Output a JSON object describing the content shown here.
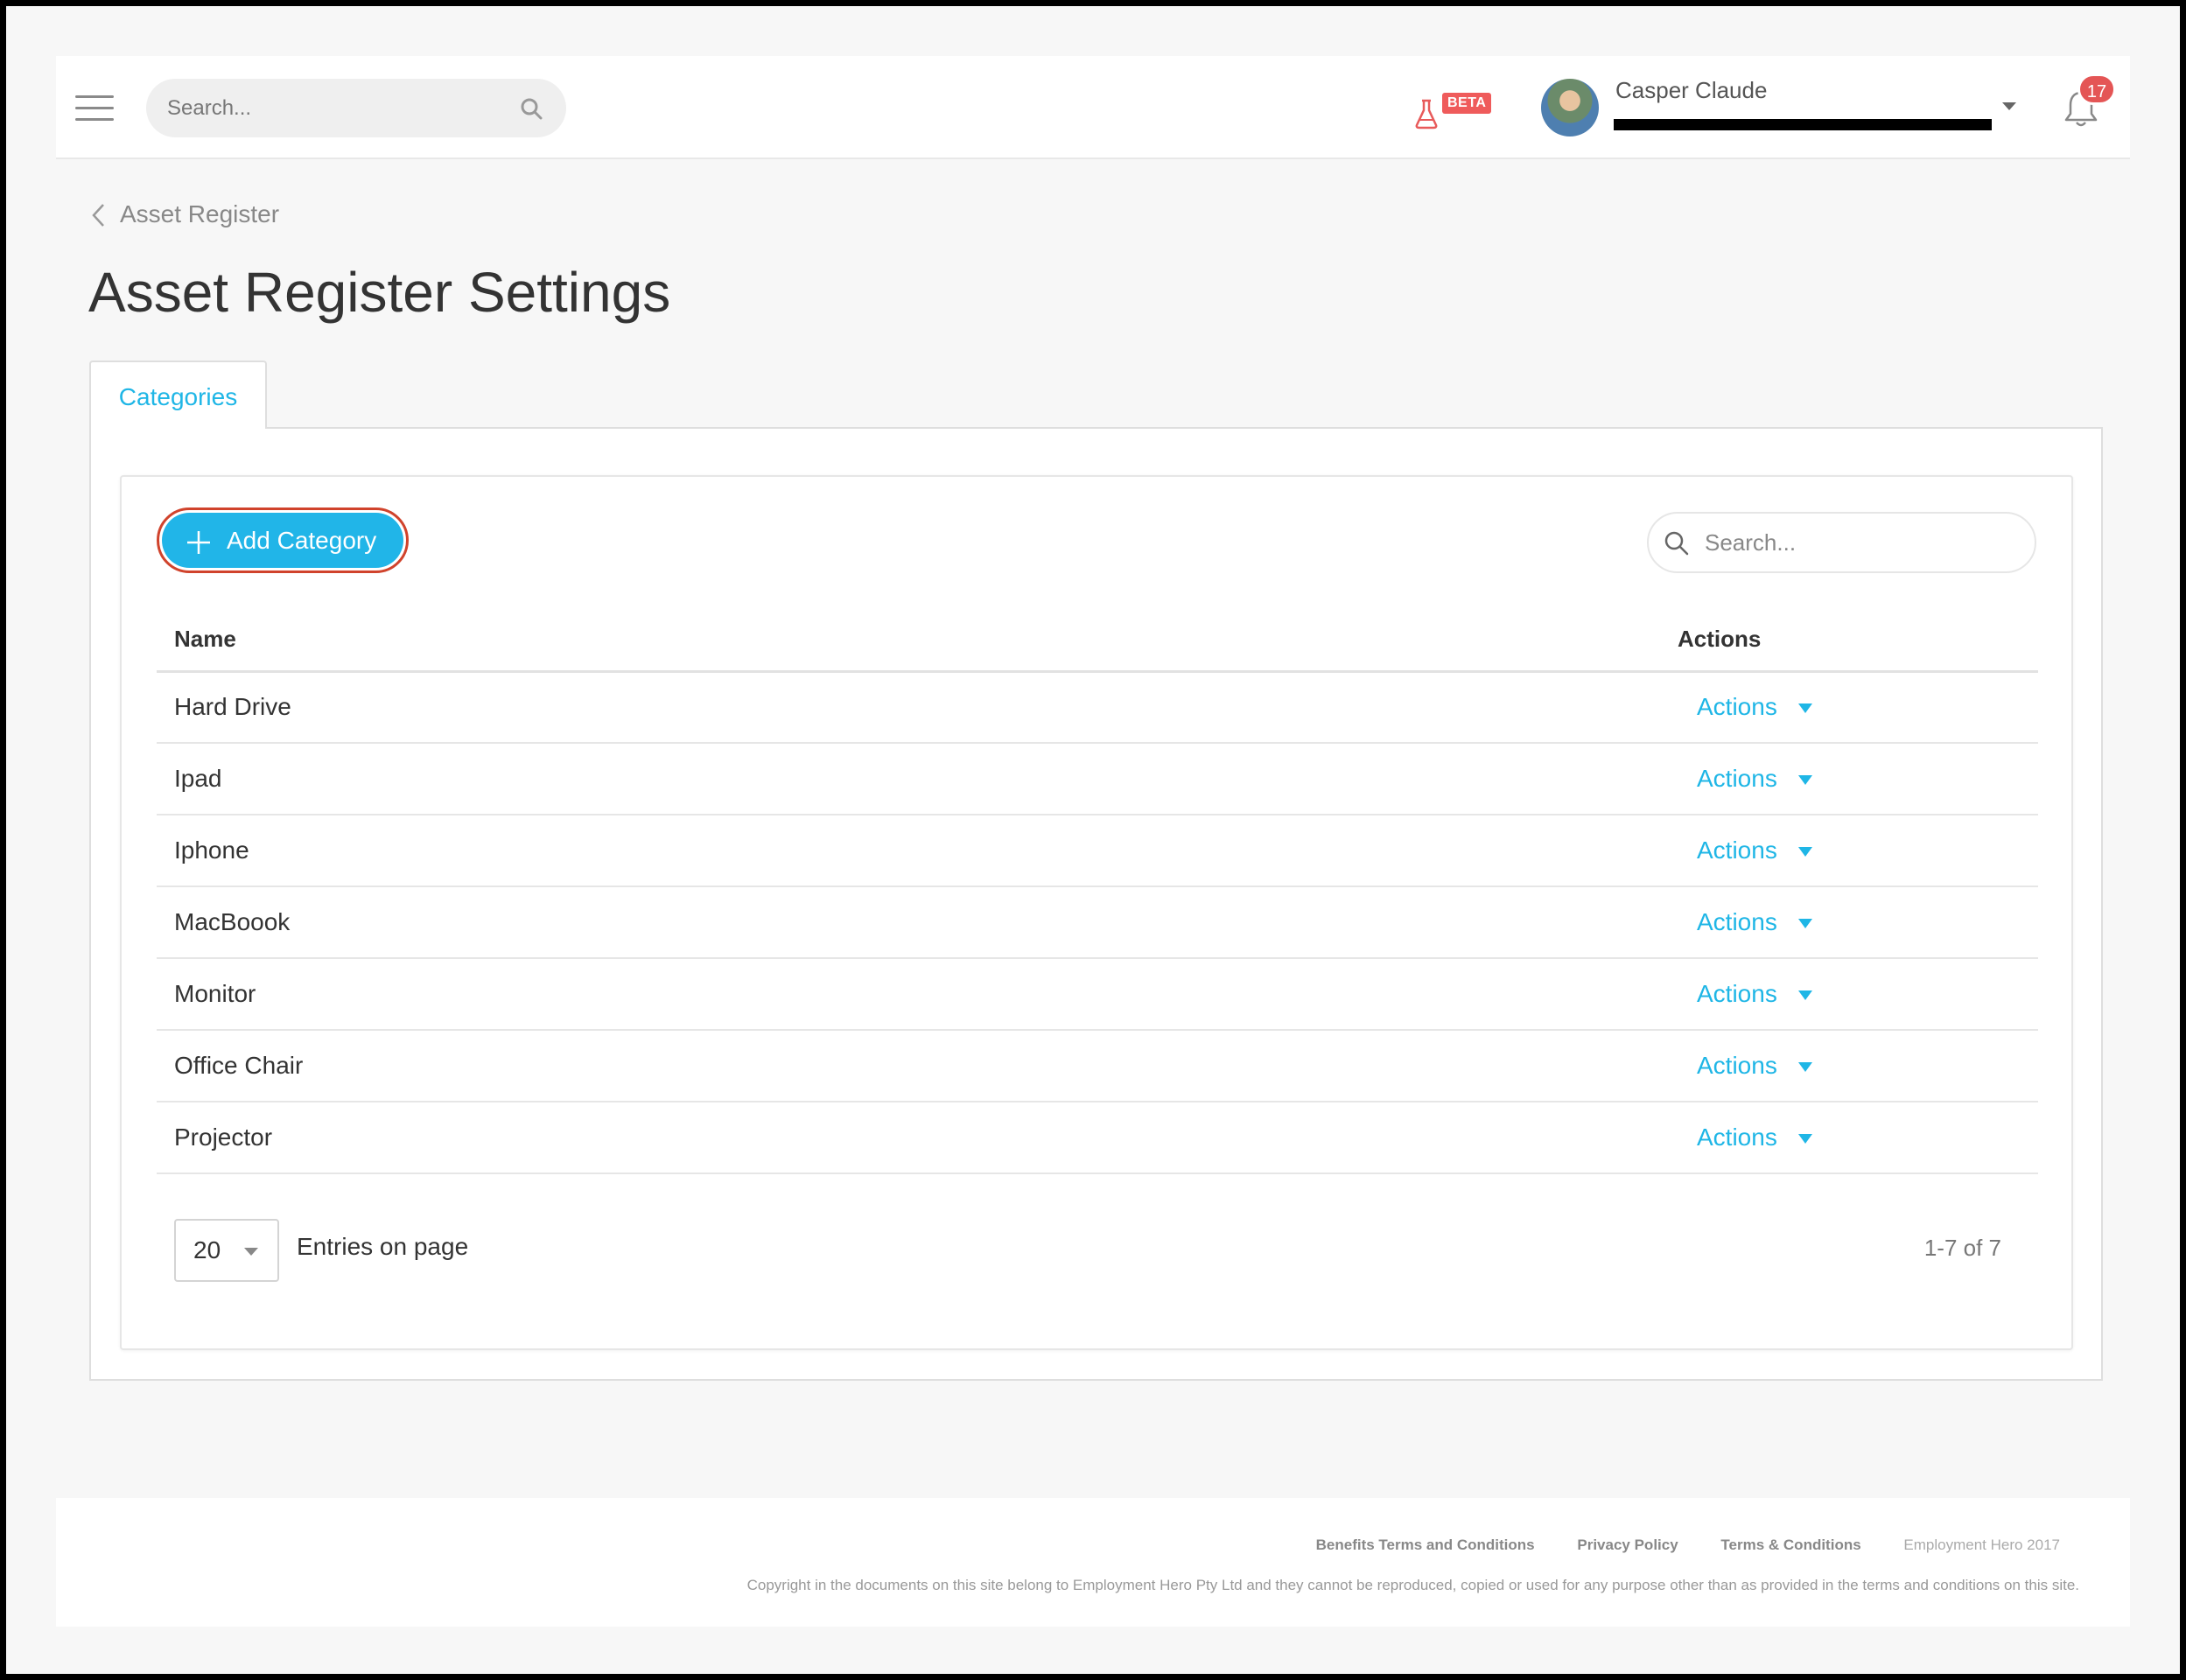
{
  "header": {
    "search_placeholder": "Search...",
    "beta_label": "BETA",
    "user_name": "Casper Claude",
    "notification_count": "17"
  },
  "breadcrumb": {
    "label": "Asset Register"
  },
  "page": {
    "title": "Asset Register Settings"
  },
  "tabs": [
    {
      "label": "Categories",
      "active": true
    }
  ],
  "toolbar": {
    "add_button_label": "Add Category",
    "search_placeholder": "Search..."
  },
  "table": {
    "columns": [
      "Name",
      "Actions"
    ],
    "rows": [
      {
        "name": "Hard Drive",
        "action": "Actions"
      },
      {
        "name": "Ipad",
        "action": "Actions"
      },
      {
        "name": "Iphone",
        "action": "Actions"
      },
      {
        "name": "MacBoook",
        "action": "Actions"
      },
      {
        "name": "Monitor",
        "action": "Actions"
      },
      {
        "name": "Office Chair",
        "action": "Actions"
      },
      {
        "name": "Projector",
        "action": "Actions"
      }
    ]
  },
  "pagination": {
    "per_page": "20",
    "per_page_label": "Entries on page",
    "range": "1-7 of 7"
  },
  "footer": {
    "links": [
      "Benefits Terms and Conditions",
      "Privacy Policy",
      "Terms & Conditions"
    ],
    "year_text": "Employment Hero 2017",
    "copyright": "Copyright in the documents on this site belong to Employment Hero Pty Ltd and they cannot be reproduced, copied or used for any purpose other than as provided in the terms and conditions on this site."
  },
  "colors": {
    "accent": "#21b5e8",
    "highlight_outline": "#d0432c",
    "badge": "#e45555"
  }
}
